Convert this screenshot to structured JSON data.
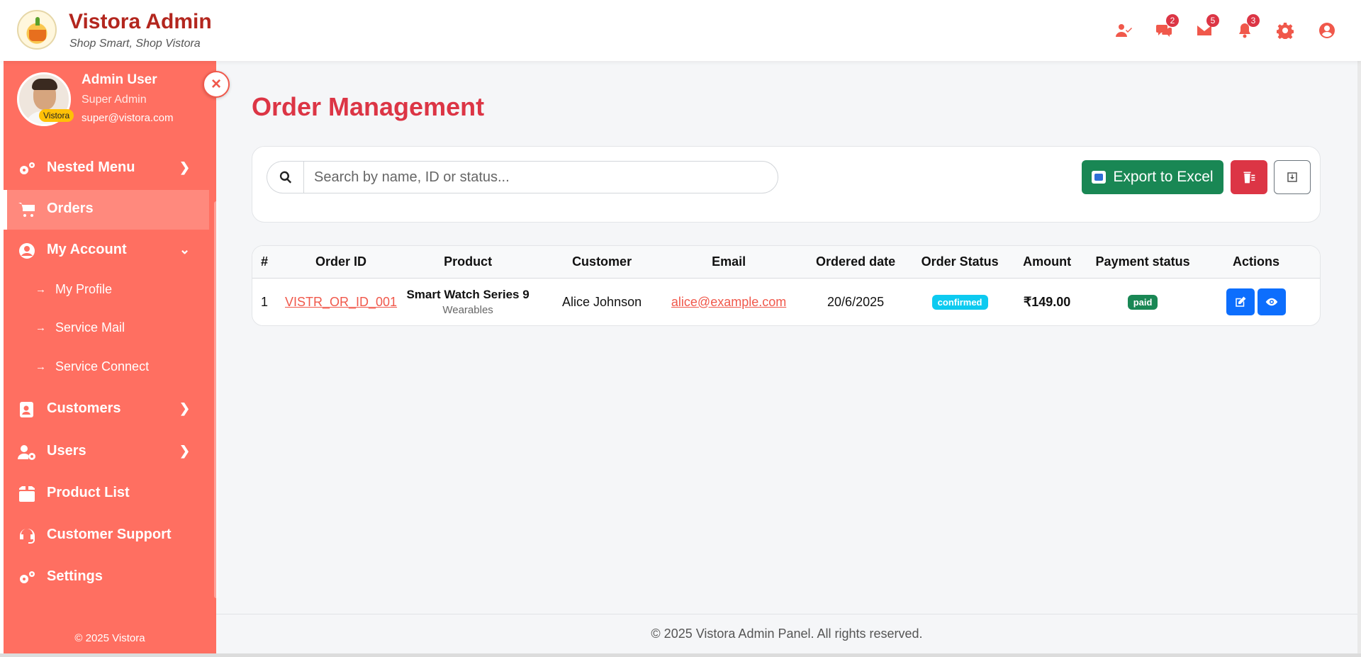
{
  "header": {
    "brand_title": "Vistora Admin",
    "brand_tagline": "Shop Smart, Shop Vistora",
    "icons": [
      {
        "name": "user-check-icon",
        "badge": ""
      },
      {
        "name": "chat-icon",
        "badge": "2"
      },
      {
        "name": "mail-icon",
        "badge": "5"
      },
      {
        "name": "bell-icon",
        "badge": "3"
      },
      {
        "name": "gear-icon",
        "badge": ""
      },
      {
        "name": "user-circle-icon",
        "badge": ""
      }
    ]
  },
  "sidebar": {
    "user_name": "Admin User",
    "user_role": "Super Admin",
    "user_email": "super@vistora.com",
    "avatar_tag": "Vistora",
    "close_icon": "×",
    "items": [
      {
        "label": "Nested Menu",
        "icon": "gears-icon",
        "chevron": "right"
      },
      {
        "label": "Orders",
        "icon": "cart-icon",
        "active": true
      },
      {
        "label": "My Account",
        "icon": "user-circle-icon",
        "chevron": "down"
      },
      {
        "label": "Customers",
        "icon": "address-book-icon",
        "chevron": "right"
      },
      {
        "label": "Users",
        "icon": "users-gear-icon",
        "chevron": "right"
      },
      {
        "label": "Product List",
        "icon": "box-icon"
      },
      {
        "label": "Customer Support",
        "icon": "headset-icon"
      },
      {
        "label": "Settings",
        "icon": "gears-icon"
      }
    ],
    "sub_items": [
      {
        "label": "My Profile"
      },
      {
        "label": "Service Mail"
      },
      {
        "label": "Service Connect"
      }
    ],
    "footer": "© 2025 Vistora"
  },
  "main": {
    "page_title": "Order Management",
    "search": {
      "placeholder": "Search by name, ID or status...",
      "value": ""
    },
    "export_label": "Export to Excel",
    "table": {
      "headers": [
        "#",
        "Order ID",
        "Product",
        "Customer",
        "Email",
        "Ordered date",
        "Order Status",
        "Amount",
        "Payment status",
        "Actions"
      ],
      "rows": [
        {
          "num": "1",
          "order_id": "VISTR_OR_ID_001",
          "product": "Smart Watch Series 9",
          "category": "Wearables",
          "customer": "Alice Johnson",
          "email": "alice@example.com",
          "date": "20/6/2025",
          "status": "confirmed",
          "amount": "₹149.00",
          "payment": "paid"
        }
      ]
    }
  },
  "footer": {
    "text": "© 2025 Vistora Admin Panel. All rights reserved."
  },
  "colors": {
    "brand": "#ff6f61",
    "title_red": "#dc3545",
    "export_green": "#198754",
    "action_blue": "#0d6efd",
    "status_cyan": "#0dcaf0"
  }
}
